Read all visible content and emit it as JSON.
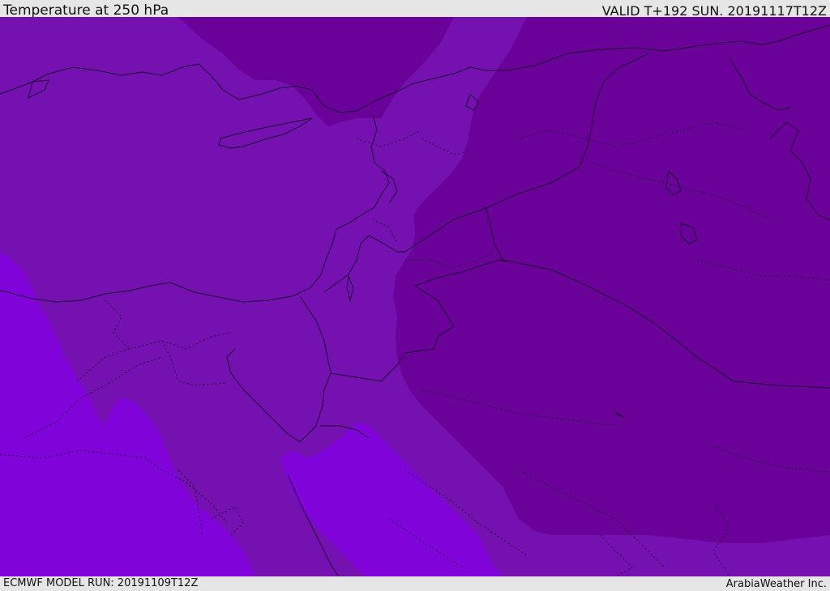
{
  "header": {
    "title": "Temperature at 250 hPa",
    "valid_time": "VALID T+192 SUN. 20191117T12Z"
  },
  "footer": {
    "model_run": "ECMWF MODEL RUN: 20191109T12Z",
    "credit": "ArabiaWeather Inc."
  },
  "map": {
    "colors": {
      "cold_band": "#6a0199",
      "mid_band": "#7510b1",
      "warm_band": "#8003d9",
      "lines": "#1a0030"
    }
  }
}
